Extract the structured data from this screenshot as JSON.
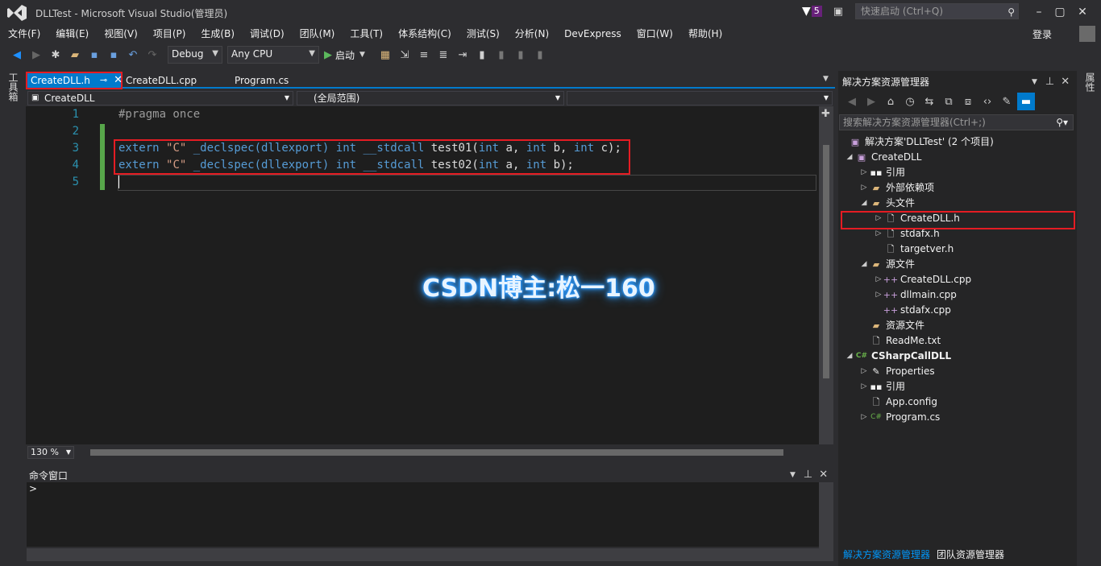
{
  "window": {
    "title": "DLLTest - Microsoft Visual Studio(管理员)",
    "notification_count": "5",
    "quick_launch_placeholder": "快速启动 (Ctrl+Q)",
    "login_label": "登录"
  },
  "menu": [
    "文件(F)",
    "编辑(E)",
    "视图(V)",
    "项目(P)",
    "生成(B)",
    "调试(D)",
    "团队(M)",
    "工具(T)",
    "体系结构(C)",
    "测试(S)",
    "分析(N)",
    "DevExpress",
    "窗口(W)",
    "帮助(H)"
  ],
  "toolbar": {
    "config": "Debug",
    "platform": "Any CPU",
    "start_label": "启动"
  },
  "toolbox_label": "工具箱",
  "properties_label": "属性",
  "editor": {
    "tabs": [
      "CreateDLL.h",
      "CreateDLL.cpp",
      "Program.cs"
    ],
    "nav_project": "CreateDLL",
    "nav_scope": "(全局范围)",
    "line_numbers": [
      "1",
      "2",
      "3",
      "4",
      "5"
    ],
    "lines": {
      "l1": "#pragma once",
      "l3": {
        "extern": "extern",
        "str": "\"C\"",
        "decl": "_declspec(dllexport)",
        "int": "int",
        "call": "__stdcall",
        "name": "test01(",
        "p1t": "int",
        "p1": "a,",
        "p2t": "int",
        "p2": "b,",
        "p3t": "int",
        "p3": "c);"
      },
      "l4": {
        "extern": "extern",
        "str": "\"C\"",
        "decl": "_declspec(dllexport)",
        "int": "int",
        "call": "__stdcall",
        "name": "test02(",
        "p1t": "int",
        "p1": "a,",
        "p2t": "int",
        "p2": "b);"
      }
    },
    "zoom": "130 %",
    "watermark": "CSDN博主:松一160"
  },
  "command_window": {
    "title": "命令窗口",
    "prompt": ">"
  },
  "solution_explorer": {
    "title": "解决方案资源管理器",
    "search_placeholder": "搜索解决方案资源管理器(Ctrl+;)",
    "tree": {
      "solution": "解决方案'DLLTest' (2 个项目)",
      "proj1": "CreateDLL",
      "refs1": "引用",
      "extdeps": "外部依赖项",
      "headers": "头文件",
      "h1": "CreateDLL.h",
      "h2": "stdafx.h",
      "h3": "targetver.h",
      "sources": "源文件",
      "s1": "CreateDLL.cpp",
      "s2": "dllmain.cpp",
      "s3": "stdafx.cpp",
      "resources": "资源文件",
      "readme": "ReadMe.txt",
      "proj2": "CSharpCallDLL",
      "props": "Properties",
      "refs2": "引用",
      "appconfig": "App.config",
      "programcs": "Program.cs"
    },
    "bottom_tabs": [
      "解决方案资源管理器",
      "团队资源管理器"
    ]
  },
  "colors": {
    "accent": "#007acc",
    "highlight": "#e51c23",
    "keyword": "#569cd6",
    "string": "#d69d85",
    "line_number": "#2b91af"
  }
}
